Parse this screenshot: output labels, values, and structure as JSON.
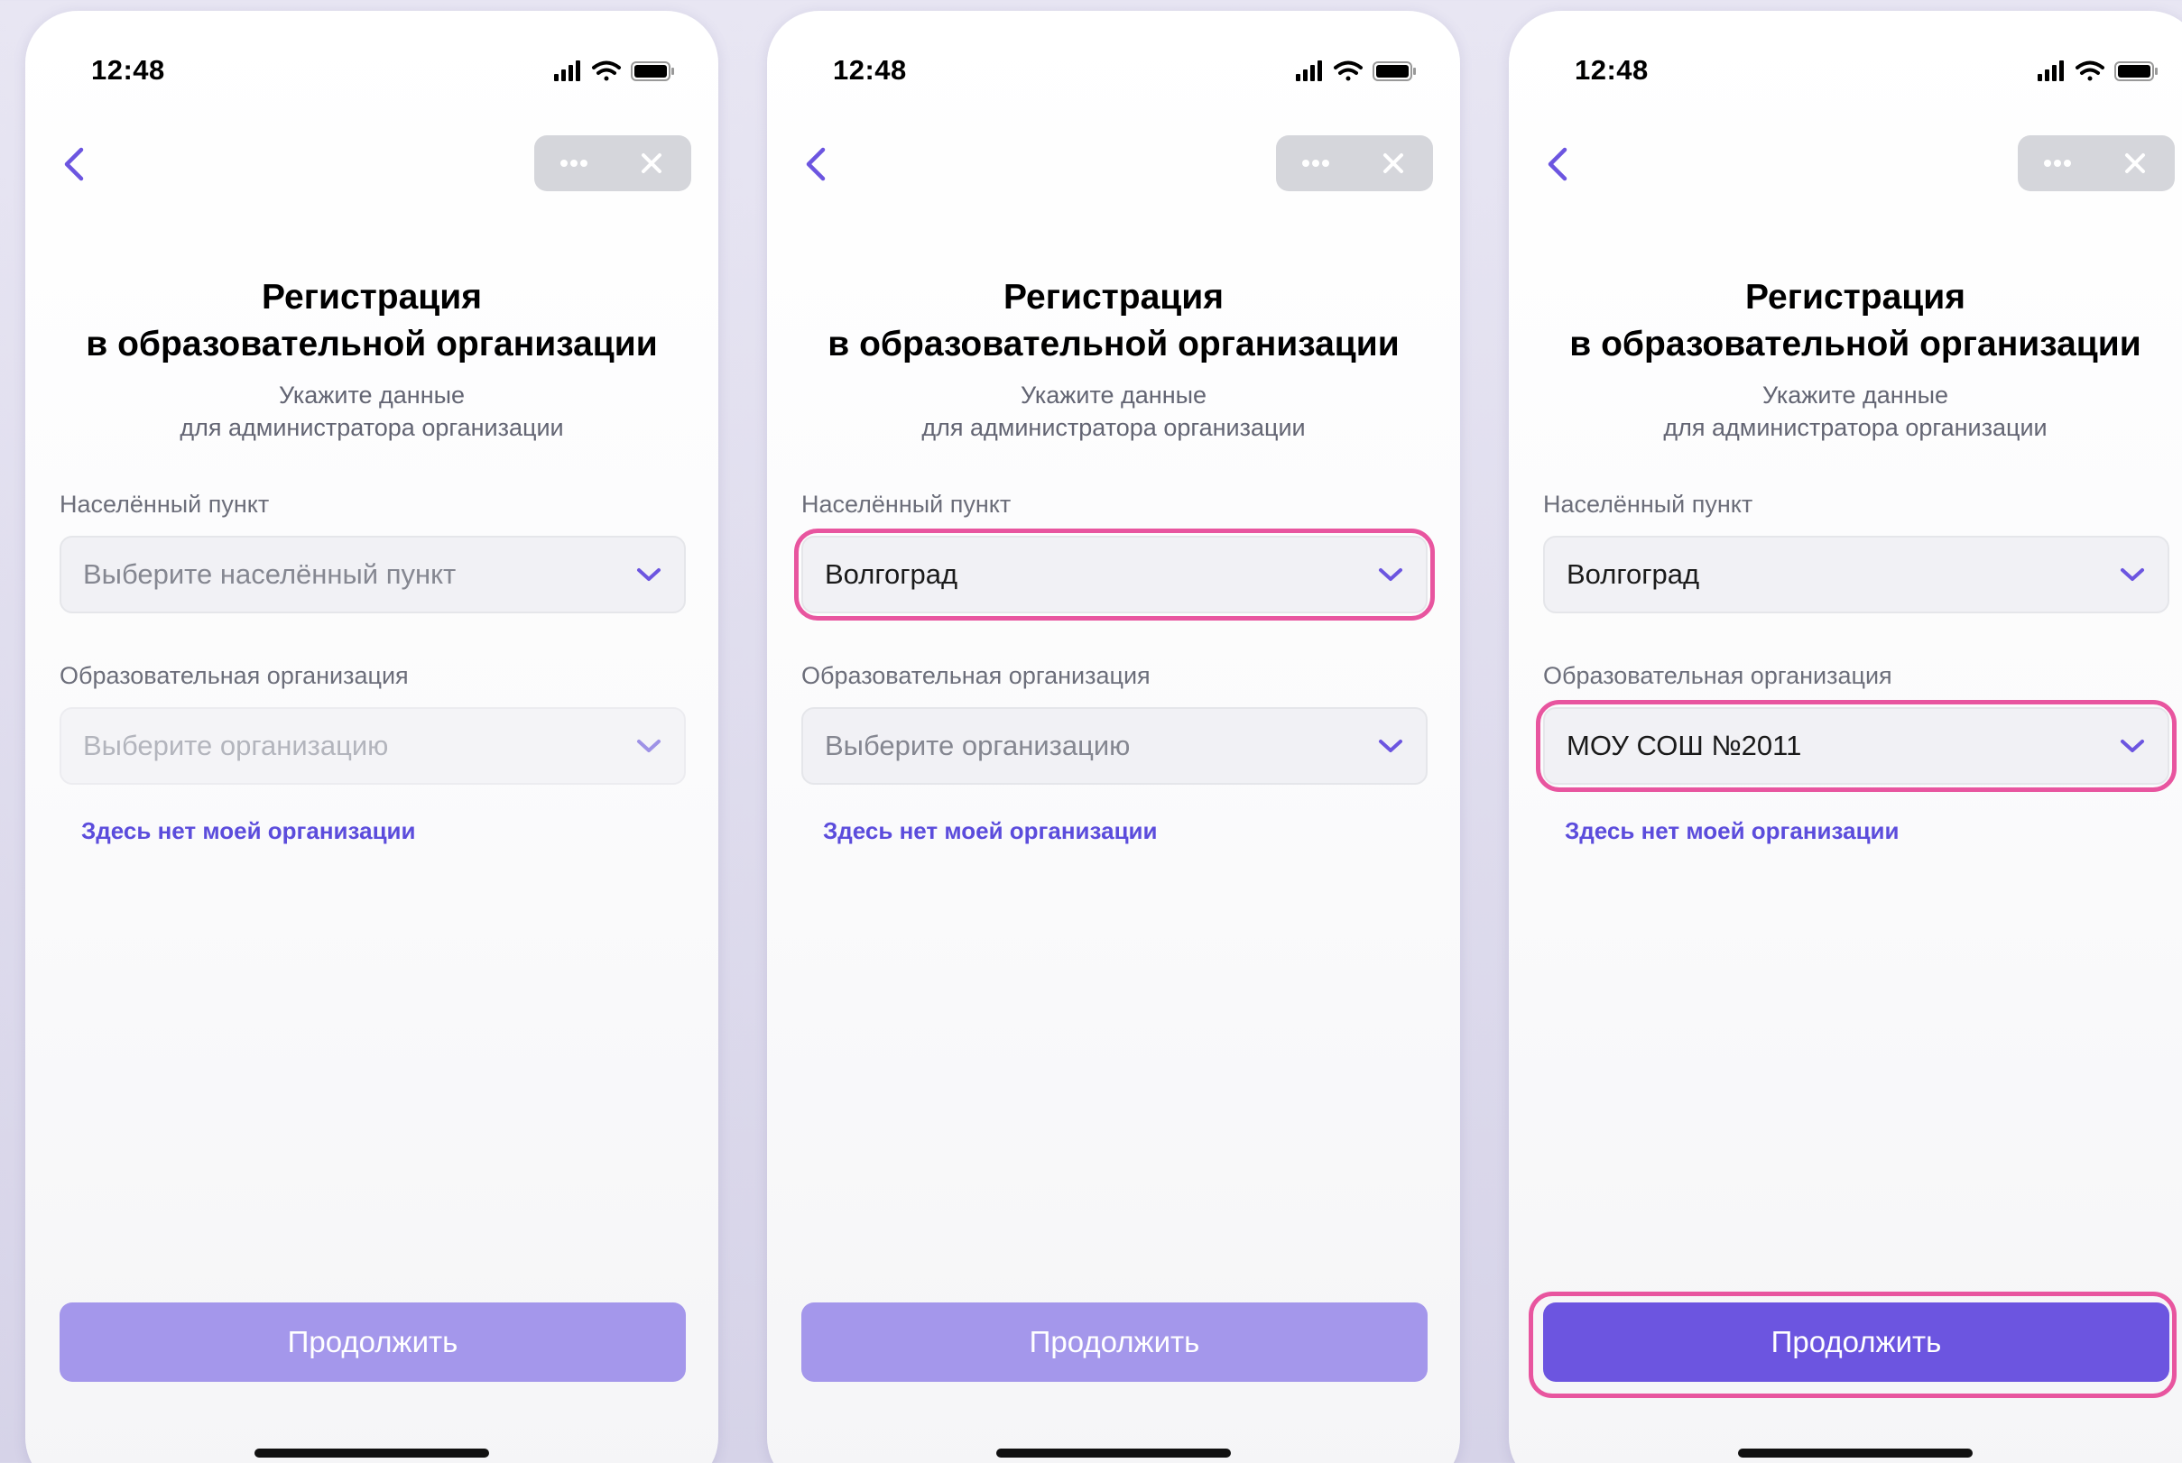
{
  "colors": {
    "accent": "#6c55e0",
    "accent_inactive": "#a497eb",
    "highlight": "#e8559f",
    "link": "#5b4cdc"
  },
  "screens": [
    {
      "status": {
        "time": "12:48"
      },
      "title_line1": "Регистрация",
      "title_line2": "в образовательной организации",
      "subtitle_line1": "Укажите данные",
      "subtitle_line2": "для администратора организации",
      "city": {
        "label": "Населённый пункт",
        "value": "Выберите населённый пункт",
        "is_placeholder": true
      },
      "org": {
        "label": "Образовательная организация",
        "value": "Выберите организацию",
        "is_placeholder": true,
        "disabled": true
      },
      "missing_org_link": "Здесь нет моей организации",
      "continue_label": "Продолжить",
      "continue_active": false
    },
    {
      "status": {
        "time": "12:48"
      },
      "title_line1": "Регистрация",
      "title_line2": "в образовательной организации",
      "subtitle_line1": "Укажите данные",
      "subtitle_line2": "для администратора организации",
      "city": {
        "label": "Населённый пункт",
        "value": "Волгоград",
        "is_placeholder": false,
        "highlighted": true
      },
      "org": {
        "label": "Образовательная организация",
        "value": "Выберите организацию",
        "is_placeholder": true
      },
      "missing_org_link": "Здесь нет моей организации",
      "continue_label": "Продолжить",
      "continue_active": false
    },
    {
      "status": {
        "time": "12:48"
      },
      "title_line1": "Регистрация",
      "title_line2": "в образовательной организации",
      "subtitle_line1": "Укажите данные",
      "subtitle_line2": "для администратора организации",
      "city": {
        "label": "Населённый пункт",
        "value": "Волгоград",
        "is_placeholder": false
      },
      "org": {
        "label": "Образовательная организация",
        "value": "МОУ СОШ №2011",
        "is_placeholder": false,
        "highlighted": true
      },
      "missing_org_link": "Здесь нет моей организации",
      "continue_label": "Продолжить",
      "continue_active": true,
      "continue_highlighted": true
    }
  ]
}
